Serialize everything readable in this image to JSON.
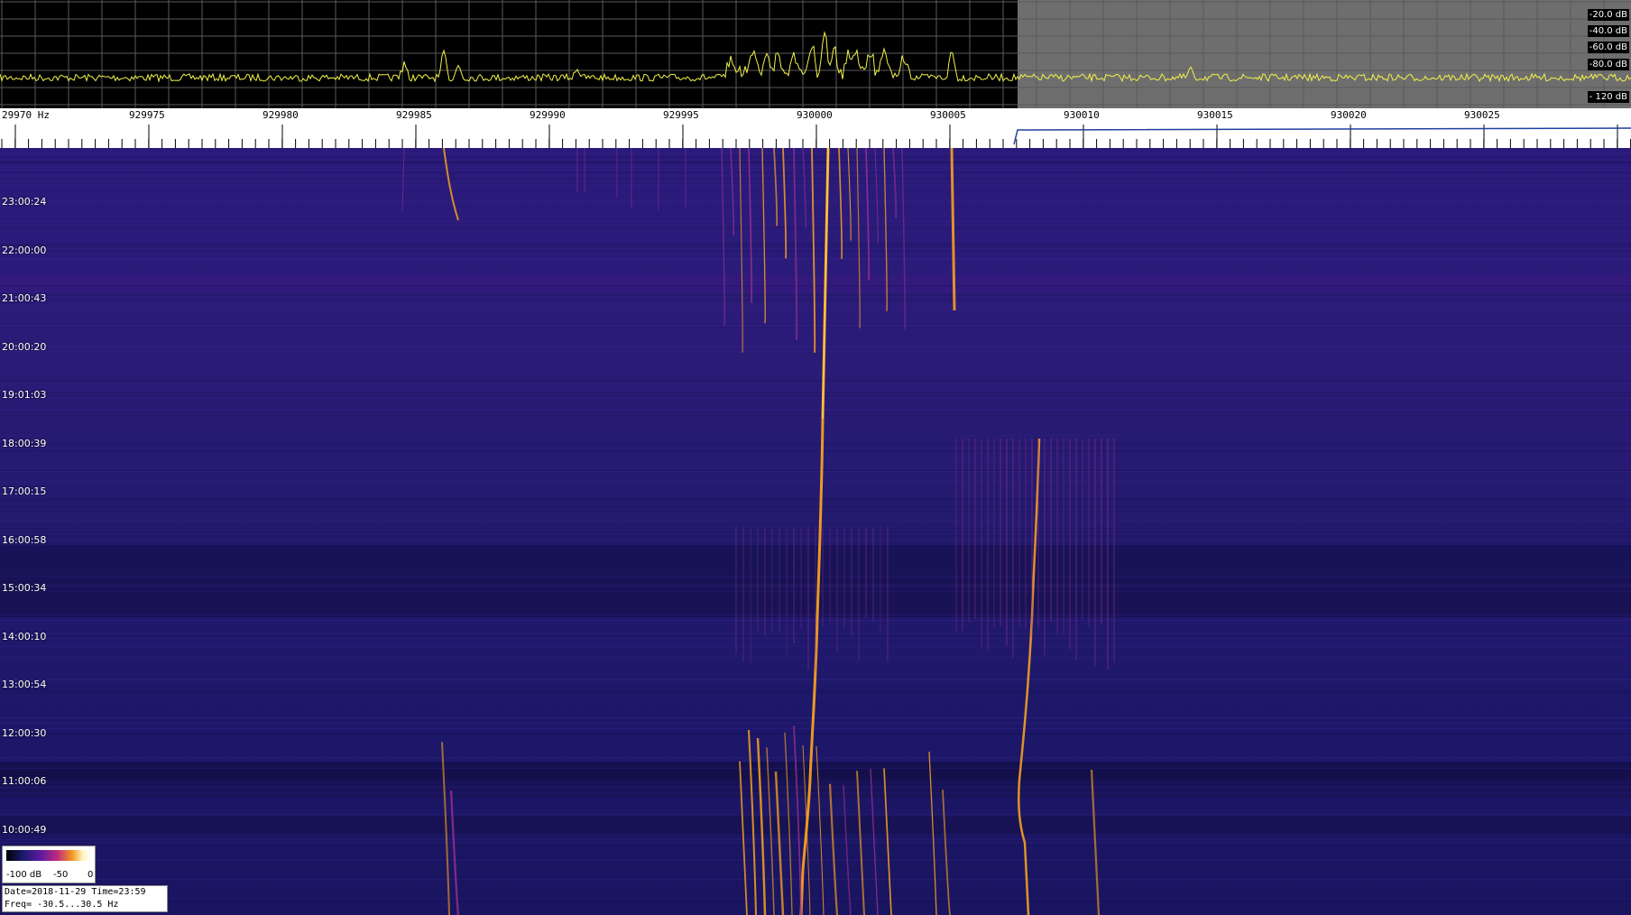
{
  "spectrum": {
    "db_labels": [
      "-20.0 dB",
      "-40.0 dB",
      "-60.0 dB",
      "-80.0 dB",
      "- 120 dB"
    ],
    "trace_color": "#f2f24a",
    "left_bg": "#000000",
    "right_bg": "#6e6e6e"
  },
  "ruler": {
    "freq_labels": [
      "29970 Hz",
      "929975",
      "929980",
      "929985",
      "929990",
      "929995",
      "930000",
      "930005",
      "930010",
      "930015",
      "930020",
      "930025"
    ]
  },
  "waterfall": {
    "time_labels": [
      "23:00:24",
      "22:00:00",
      "21:00:43",
      "20:00:20",
      "19:01:03",
      "18:00:39",
      "17:00:15",
      "16:00:58",
      "15:00:34",
      "14:00:10",
      "13:00:54",
      "12:00:30",
      "11:00:06",
      "10:00:49"
    ],
    "bg_color": "#1c1566",
    "trace_color": "#f5a020"
  },
  "colorbar": {
    "min_label": "-100 dB",
    "mid_label": "-50",
    "max_label": "0"
  },
  "info": {
    "line1": "Date=2018-11-29 Time=23:59",
    "line2": "Freq= -30.5...30.5 Hz"
  }
}
